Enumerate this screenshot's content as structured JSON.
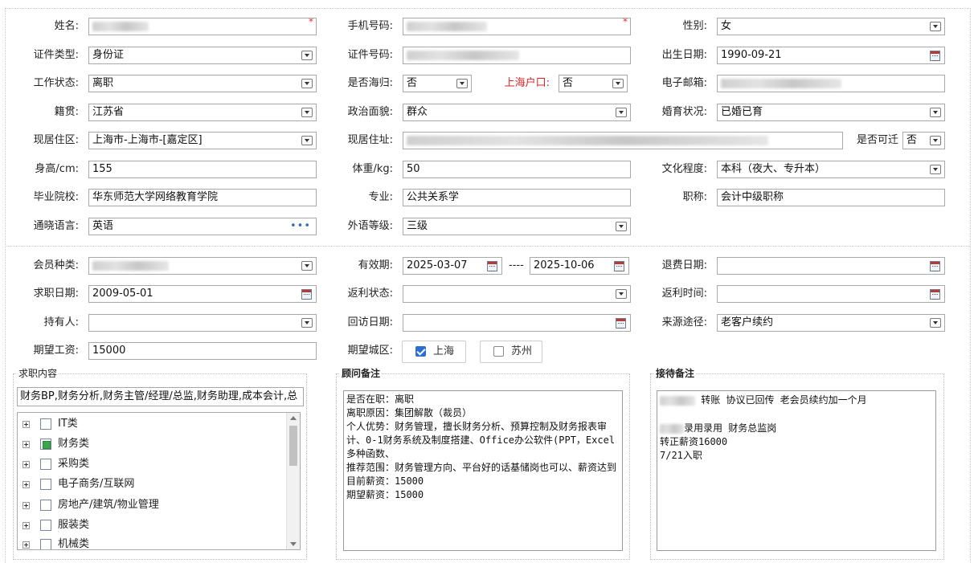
{
  "personal": {
    "name_label": "姓名:",
    "phone_label": "手机号码:",
    "gender_label": "性别:",
    "gender_value": "女",
    "id_type_label": "证件类型:",
    "id_type_value": "身份证",
    "id_no_label": "证件号码:",
    "birth_label": "出生日期:",
    "birth_value": "1990-09-21",
    "work_status_label": "工作状态:",
    "work_status_value": "离职",
    "returnee_label": "是否海归:",
    "returnee_value": "否",
    "hukou_label": "上海户口:",
    "hukou_value": "否",
    "email_label": "电子邮箱:",
    "native_label": "籍贯:",
    "native_value": "江苏省",
    "politics_label": "政治面貌:",
    "politics_value": "群众",
    "marital_label": "婚育状况:",
    "marital_value": "已婚已育",
    "residence_label": "现居住区:",
    "residence_value": "上海市-上海市-[嘉定区]",
    "address_label": "现居住址:",
    "relocate_label": "是否可迁",
    "relocate_value": "否",
    "height_label": "身高/cm:",
    "height_value": "155",
    "weight_label": "体重/kg:",
    "weight_value": "50",
    "education_label": "文化程度:",
    "education_value": "本科（夜大、专升本）",
    "school_label": "毕业院校:",
    "school_value": "华东师范大学网络教育学院",
    "major_label": "专业:",
    "major_value": "公共关系学",
    "title_label": "职称:",
    "title_value": "会计中级职称",
    "language_label": "通晓语言:",
    "language_value": "英语",
    "lang_level_label": "外语等级:",
    "lang_level_value": "三级",
    "required_mark": "*"
  },
  "membership": {
    "member_type_label": "会员种类:",
    "valid_label": "有效期:",
    "valid_from": "2025-03-07",
    "valid_sep": "----",
    "valid_to": "2025-10-06",
    "refund_date_label": "退费日期:",
    "refund_date_value": "",
    "job_date_label": "求职日期:",
    "job_date_value": "2009-05-01",
    "rebate_status_label": "返利状态:",
    "rebate_status_value": "",
    "rebate_time_label": "返利时间:",
    "rebate_time_value": "",
    "holder_label": "持有人:",
    "holder_value": "",
    "revisit_label": "回访日期:",
    "revisit_value": "",
    "source_label": "来源途径:",
    "source_value": "老客户续约",
    "salary_label": "期望工资:",
    "salary_value": "15000",
    "city_label": "期望城区:",
    "cities": [
      {
        "label": "上海",
        "checked": true
      },
      {
        "label": "苏州",
        "checked": false
      }
    ]
  },
  "job_content": {
    "title": "求职内容",
    "summary": "财务BP,财务分析,财务主管/经理/总监,财务助理,成本会计,总",
    "categories": [
      {
        "label": "IT类",
        "checked": false
      },
      {
        "label": "财务类",
        "checked": true
      },
      {
        "label": "采购类",
        "checked": false
      },
      {
        "label": "电子商务/互联网",
        "checked": false
      },
      {
        "label": "房地产/建筑/物业管理",
        "checked": false
      },
      {
        "label": "服装类",
        "checked": false
      },
      {
        "label": "机械类",
        "checked": false
      }
    ]
  },
  "advisor_notes": {
    "title": "顾问备注",
    "text": "是否在职：离职\n离职原因：集团解散（裁员）\n个人优势：财务管理，擅长财务分析、预算控制及财务报表审计、0-1财务系统及制度搭建、Office办公软件(PPT，Excel多种函数、\n推荐范围：财务管理方向、平台好的话基储岗也可以、薪资达到\n目前薪资：15000\n期望薪资：15000"
  },
  "reception_notes": {
    "title": "接待备注",
    "line1": " 转账 协议已回传  老会员续约加一个月",
    "line2": "录用录用 财务总监岗",
    "line3": "转正薪资16000",
    "line4": "7/21入职"
  }
}
